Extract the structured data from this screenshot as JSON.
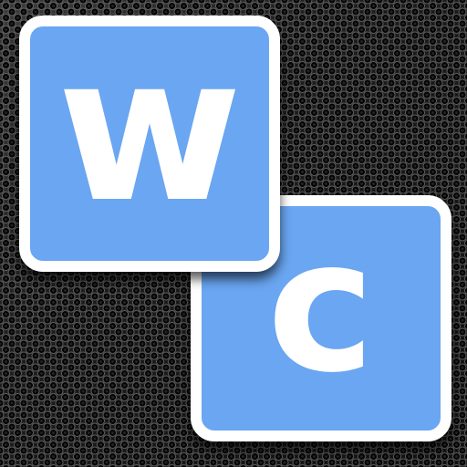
{
  "tiles": [
    {
      "letter": "w"
    },
    {
      "letter": "c"
    }
  ],
  "colors": {
    "tile_fill": "#6aa6f2",
    "tile_border": "#ffffff",
    "background": "#1f1f1f"
  }
}
